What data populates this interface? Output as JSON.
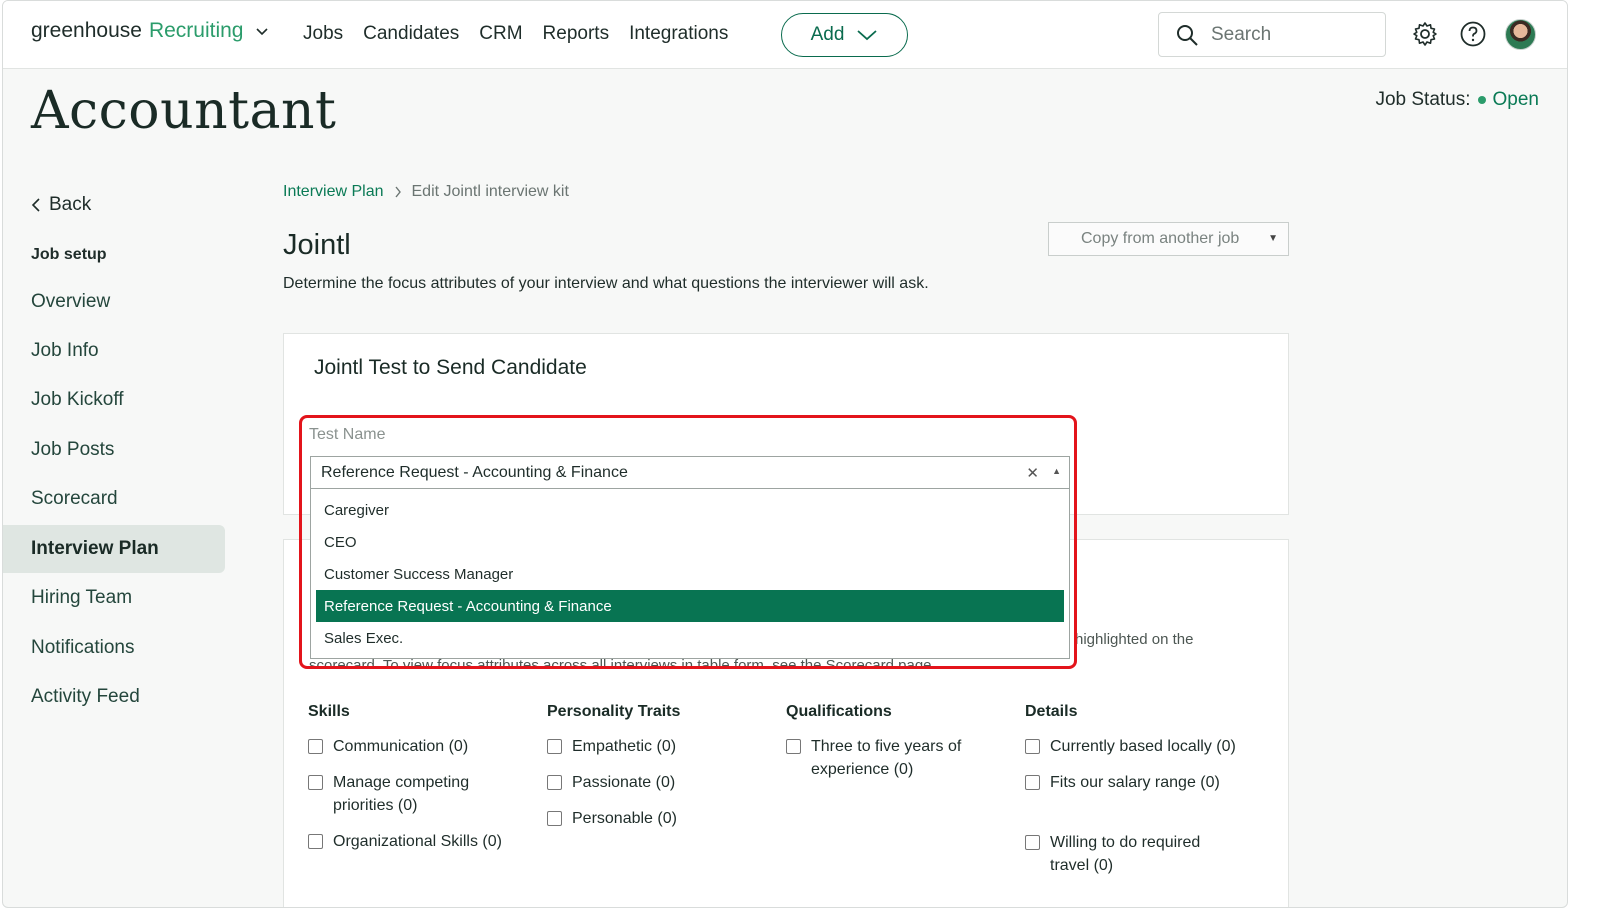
{
  "nav": {
    "brand_name": "greenhouse",
    "brand_product": "Recruiting",
    "links": [
      "Jobs",
      "Candidates",
      "CRM",
      "Reports",
      "Integrations"
    ],
    "add_label": "Add",
    "search_placeholder": "Search"
  },
  "header": {
    "job_title": "Accountant",
    "status_label": "Job Status:",
    "status_value": "Open"
  },
  "sidebar": {
    "back_label": "Back",
    "section_heading": "Job setup",
    "items": [
      {
        "label": "Overview",
        "active": false
      },
      {
        "label": "Job Info",
        "active": false
      },
      {
        "label": "Job Kickoff",
        "active": false
      },
      {
        "label": "Job Posts",
        "active": false
      },
      {
        "label": "Scorecard",
        "active": false
      },
      {
        "label": "Interview Plan",
        "active": true
      },
      {
        "label": "Hiring Team",
        "active": false
      },
      {
        "label": "Notifications",
        "active": false
      },
      {
        "label": "Activity Feed",
        "active": false
      }
    ]
  },
  "main": {
    "breadcrumb_link": "Interview Plan",
    "breadcrumb_current": "Edit Jointl interview kit",
    "heading": "Jointl",
    "description": "Determine the focus attributes of your interview and what questions the interviewer will ask.",
    "copy_select_label": "Copy from another job",
    "test_card_title": "Jointl Test to Send Candidate",
    "test_name_label": "Test Name",
    "test_name_value": "Reference Request - Accounting & Finance",
    "options": [
      {
        "label": "Caregiver",
        "selected": false
      },
      {
        "label": "CEO",
        "selected": false
      },
      {
        "label": "Customer Success Manager",
        "selected": false
      },
      {
        "label": "Reference Request - Accounting & Finance",
        "selected": true
      },
      {
        "label": "Sales Exec.",
        "selected": false
      }
    ],
    "partial_text_right": "highlighted on the",
    "partial_text_bottom": "scorecard. To view focus attributes across all interviews in table form, see the Scorecard page.",
    "attributes": {
      "skills": {
        "heading": "Skills",
        "items": [
          "Communication (0)",
          "Manage competing priorities (0)",
          "Organizational Skills (0)"
        ]
      },
      "personality": {
        "heading": "Personality Traits",
        "items": [
          "Empathetic (0)",
          "Passionate (0)",
          "Personable (0)"
        ]
      },
      "qualifications": {
        "heading": "Qualifications",
        "items": [
          "Three to five years of experience (0)"
        ]
      },
      "details": {
        "heading": "Details",
        "items": [
          "Currently based locally (0)",
          "Fits our salary range (0)",
          "Willing to do required travel (0)"
        ]
      }
    }
  },
  "colors": {
    "brand_green": "#0a6b4e",
    "selected_option": "#087452",
    "highlight_red": "#e3141b",
    "status_green": "#2b9c6b"
  }
}
